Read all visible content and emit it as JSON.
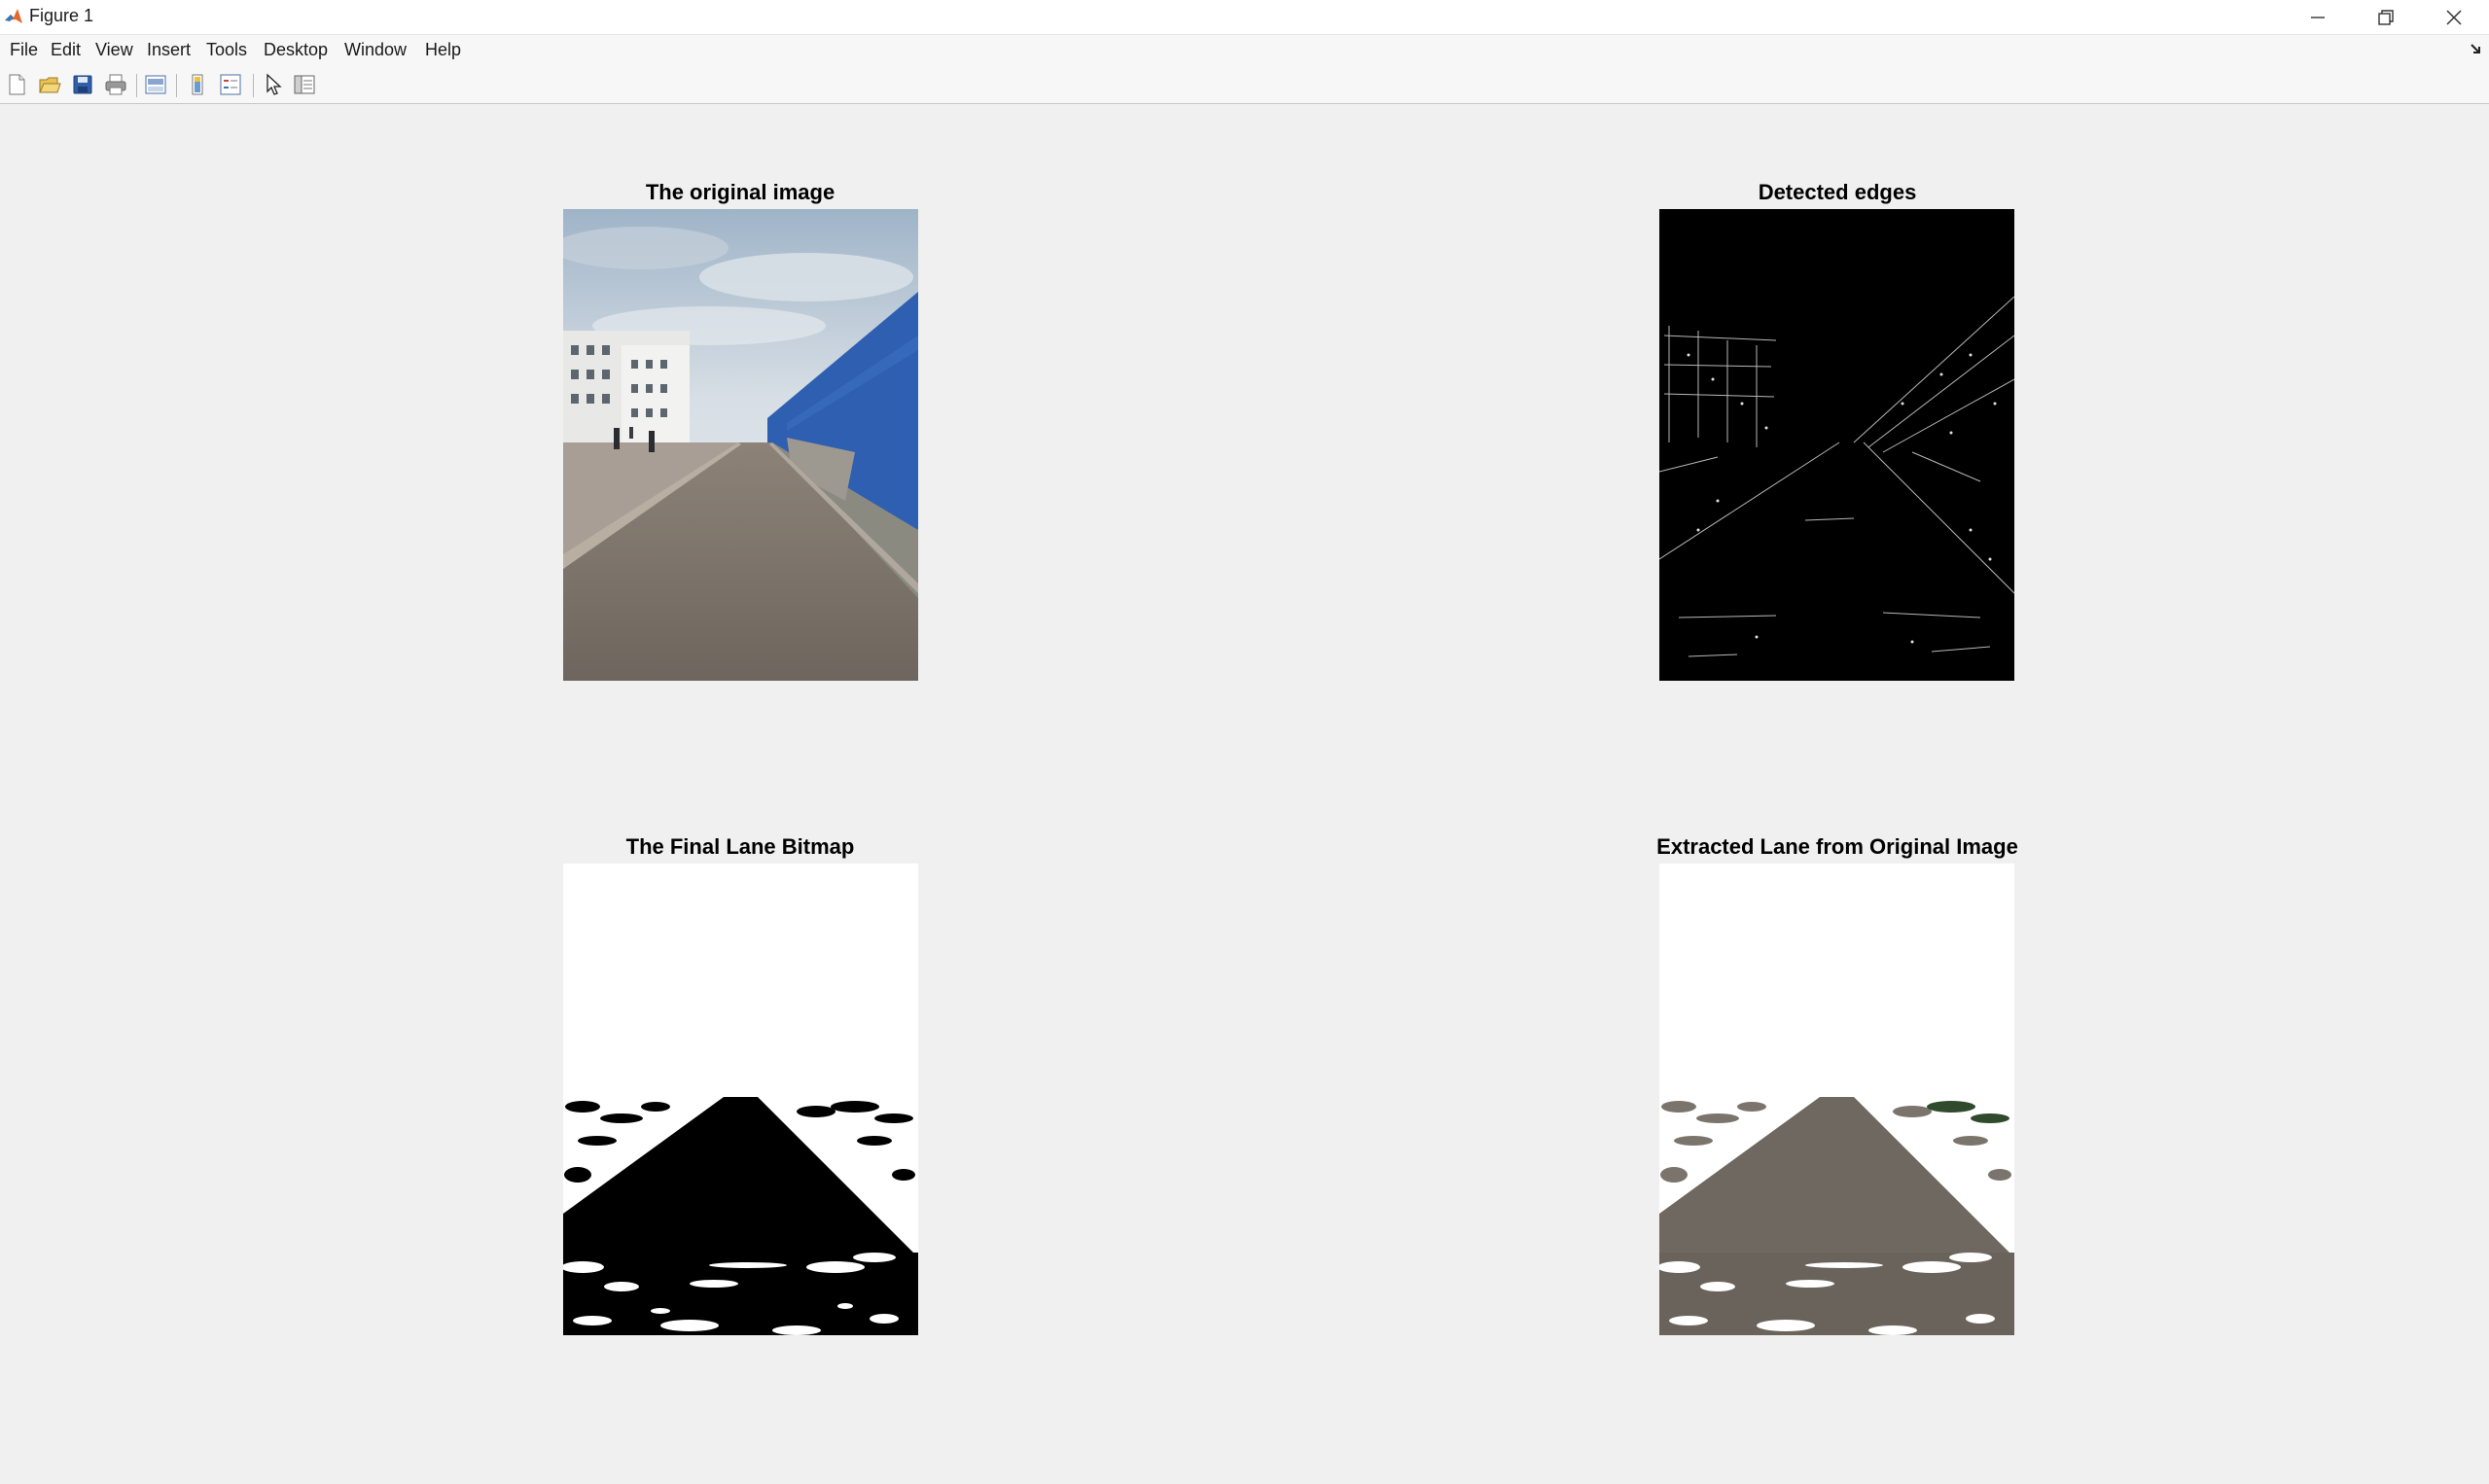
{
  "window": {
    "title": "Figure 1"
  },
  "menu": [
    "File",
    "Edit",
    "View",
    "Insert",
    "Tools",
    "Desktop",
    "Window",
    "Help"
  ],
  "toolbar_icons": [
    "new-figure-icon",
    "open-file-icon",
    "save-icon",
    "print-icon",
    "print-preview-icon",
    "colorbar-icon",
    "legend-icon",
    "select-pointer-icon",
    "property-editor-icon"
  ],
  "subplots": {
    "original": {
      "title": "The original image"
    },
    "edges": {
      "title": "Detected edges"
    },
    "bitmap": {
      "title": "The Final Lane Bitmap"
    },
    "extracted": {
      "title": "Extracted Lane from Original Image"
    }
  }
}
